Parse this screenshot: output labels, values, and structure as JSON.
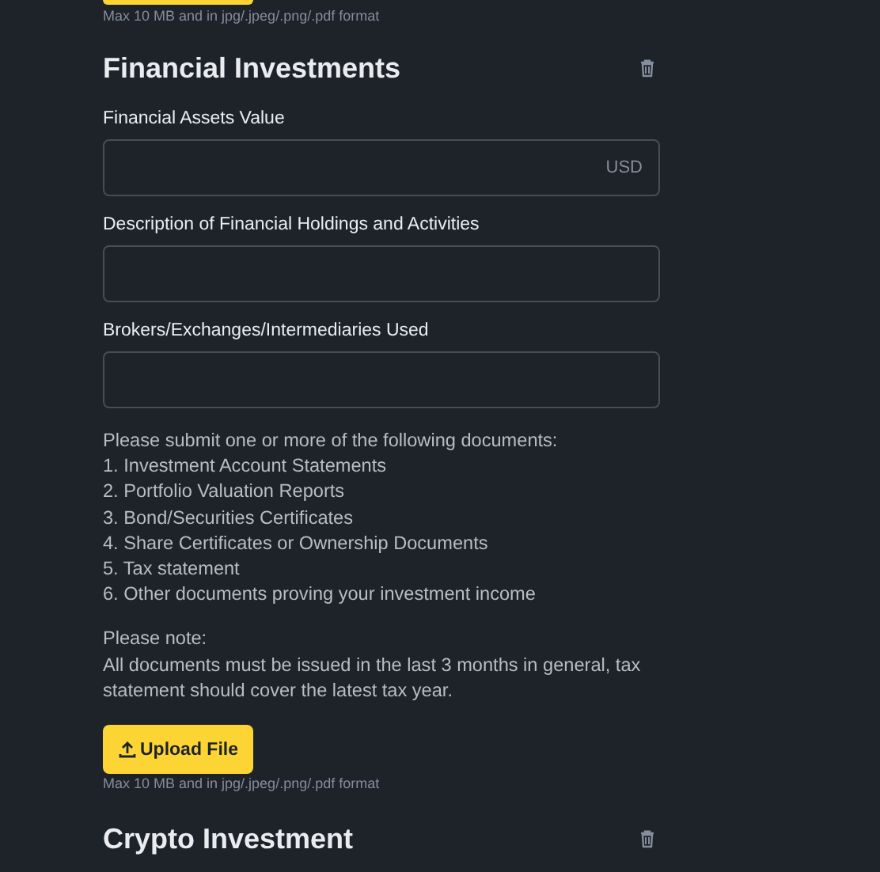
{
  "top_hint": "Max 10 MB and in jpg/.jpeg/.png/.pdf format",
  "sections": [
    {
      "title": "Financial Investments",
      "fields": [
        {
          "label": "Financial Assets Value",
          "suffix": "USD"
        },
        {
          "label": "Description of Financial Holdings and Activities"
        },
        {
          "label": "Brokers/Exchanges/Intermediaries Used"
        }
      ],
      "documents_intro": "Please submit one or more of the following documents:",
      "documents": [
        "1. Investment Account Statements",
        "2. Portfolio Valuation Reports",
        "3. Bond/Securities Certificates",
        "4. Share Certificates or Ownership Documents",
        "5. Tax statement",
        "6. Other documents proving your investment income"
      ],
      "note_title": "Please note:",
      "note": "All documents must be issued in the last 3 months in general, tax statement should cover the latest tax year.",
      "upload_button": "Upload File",
      "upload_hint": "Max 10 MB and in jpg/.jpeg/.png/.pdf format"
    },
    {
      "title": "Crypto Investment"
    }
  ]
}
